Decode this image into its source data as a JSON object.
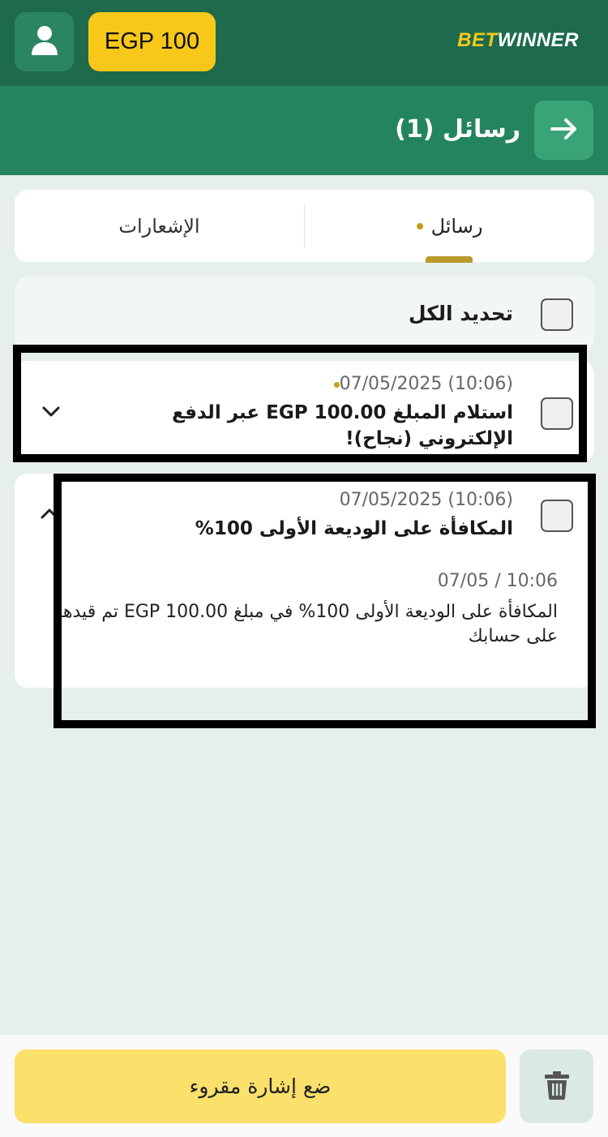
{
  "topbar": {
    "balance": "EGP 100",
    "brand_part1": "BET",
    "brand_part2": "WINNER",
    "icons": {
      "profile": "user-icon"
    }
  },
  "header": {
    "title": "رسائل (1)",
    "back_icon": "arrow-right-icon"
  },
  "tabs": [
    {
      "label": "رسائل",
      "active": true,
      "has_dot": true
    },
    {
      "label": "الإشعارات",
      "active": false
    }
  ],
  "select_all_label": "تحديد الكل",
  "messages": [
    {
      "date": "07/05/2025 (10:06)",
      "unread_dot": true,
      "title": "استلام المبلغ EGP 100.00 عبر الدفع الإلكتروني (نجاح)!",
      "expanded": false
    },
    {
      "date": "07/05/2025 (10:06)",
      "unread_dot": false,
      "title": "المكافأة على الوديعة الأولى 100%",
      "expanded": true,
      "body_date": "07/05 / 10:06",
      "body": "المكافأة على الوديعة الأولى 100% في مبلغ EGP 100.00 تم قيدها على حسابك"
    }
  ],
  "bottom": {
    "mark_read_label": "ضع إشارة مقروء",
    "delete_icon": "trash-icon"
  },
  "colors": {
    "topbar": "#1d6b4c",
    "header": "#24845e",
    "accent_yellow": "#f7c719",
    "button_yellow": "#fbe06b",
    "background": "#e6efec"
  }
}
